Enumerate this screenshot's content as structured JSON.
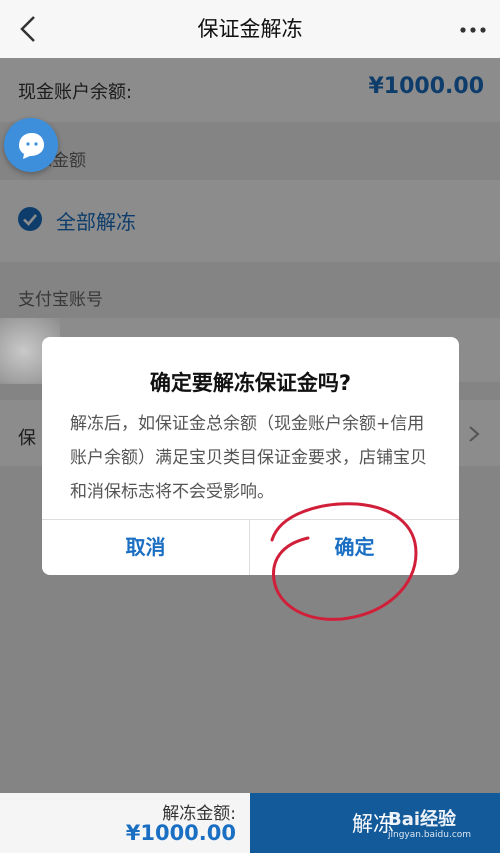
{
  "nav": {
    "title": "保证金解冻"
  },
  "balance": {
    "label": "现金账户余额:",
    "value": "¥1000.00"
  },
  "unfreeze": {
    "section_label": "解冻金额",
    "option_label": "全部解冻"
  },
  "alipay": {
    "section_label": "支付宝账号"
  },
  "bond": {
    "label": "保"
  },
  "dialog": {
    "title": "确定要解冻保证金吗?",
    "message": "解冻后，如保证金总余额（现金账户余额+信用账户余额）满足宝贝类目保证金要求，店铺宝贝和消保标志将不会受影响。",
    "cancel_label": "取消",
    "confirm_label": "确定"
  },
  "bottom": {
    "amount_label": "解冻金额:",
    "amount_value": "¥1000.00",
    "submit_label": "解冻"
  },
  "watermark": {
    "brand": "Bai经验",
    "url": "jingyan.baidu.com"
  },
  "colors": {
    "accent": "#1a6fc3",
    "submit_bg": "#135a9b",
    "annotation": "#d11f3a"
  }
}
